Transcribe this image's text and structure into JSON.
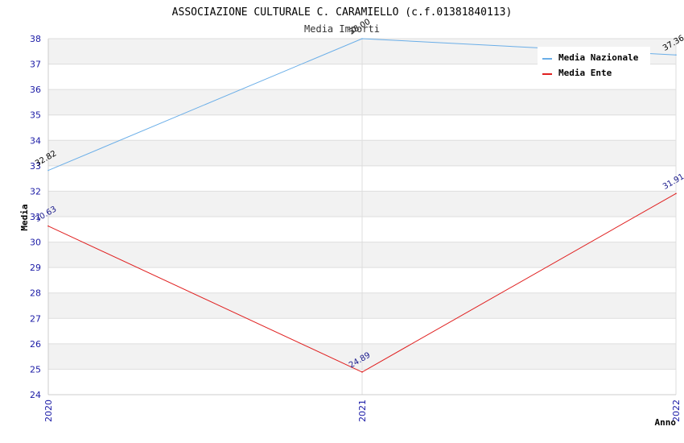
{
  "chart_data": {
    "type": "line",
    "title": "ASSOCIAZIONE CULTURALE C. CARAMIELLO (c.f.01381840113)",
    "subtitle": "Media Importi",
    "xlabel": "Anno",
    "ylabel": "Media",
    "categories": [
      "2020",
      "2021",
      "2022"
    ],
    "ylim": [
      24,
      38
    ],
    "yticks": [
      "24",
      "25",
      "26",
      "27",
      "28",
      "29",
      "30",
      "31",
      "32",
      "33",
      "34",
      "35",
      "36",
      "37",
      "38"
    ],
    "grid": true,
    "legend_position": "top-right",
    "series": [
      {
        "name": "Media Nazionale",
        "color": "#6aaee8",
        "label_color": "#000000",
        "values": [
          32.82,
          38.0,
          37.36
        ],
        "labels": [
          "32.82",
          "38.00",
          "37.36"
        ]
      },
      {
        "name": "Media Ente",
        "color": "#e02020",
        "label_color": "#1a1a8c",
        "values": [
          30.63,
          24.89,
          31.91
        ],
        "labels": [
          "30.63",
          "24.89",
          "31.91"
        ]
      }
    ]
  }
}
